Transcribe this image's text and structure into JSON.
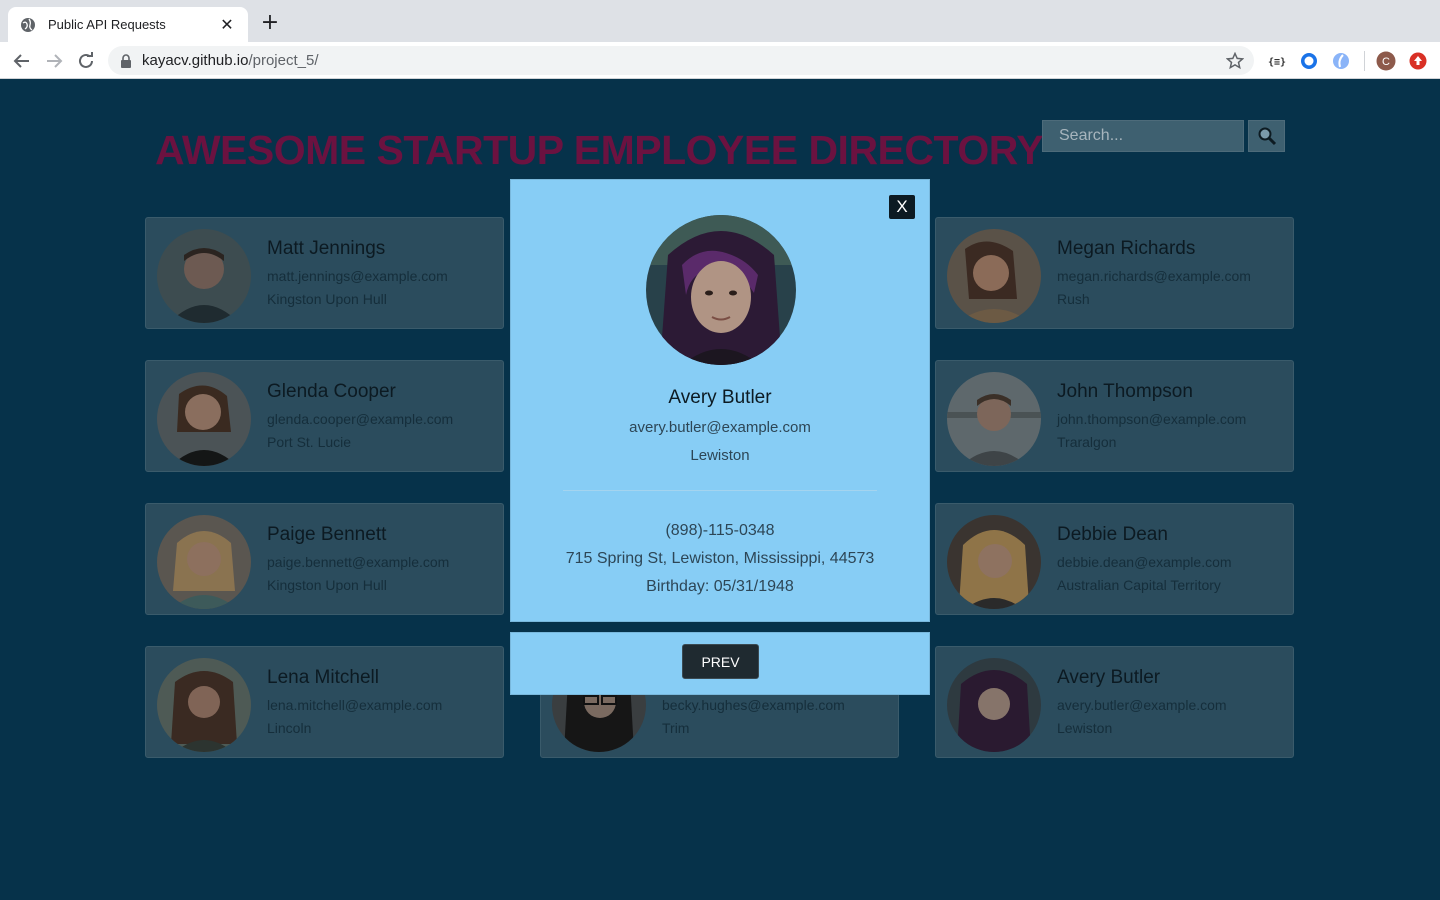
{
  "browser": {
    "tab_title": "Public API Requests",
    "tab_close": "✕",
    "new_tab": "+",
    "url_host": "kayacv.github.io",
    "url_path": "/project_5/",
    "profile_initial": "C"
  },
  "header": {
    "title": "AWESOME STARTUP EMPLOYEE DIRECTORY",
    "search_placeholder": "Search..."
  },
  "cards": [
    {
      "name": "Matt Jennings",
      "email": "matt.jennings@example.com",
      "city": "Kingston Upon Hull"
    },
    {
      "name": "Megan Richards",
      "email": "megan.richards@example.com",
      "city": "Rush"
    },
    {
      "name": "Glenda Cooper",
      "email": "glenda.cooper@example.com",
      "city": "Port St. Lucie"
    },
    {
      "name": "John Thompson",
      "email": "john.thompson@example.com",
      "city": "Traralgon"
    },
    {
      "name": "Paige Bennett",
      "email": "paige.bennett@example.com",
      "city": "Kingston Upon Hull"
    },
    {
      "name": "Debbie Dean",
      "email": "debbie.dean@example.com",
      "city": "Australian Capital Territory"
    },
    {
      "name": "Lena Mitchell",
      "email": "lena.mitchell@example.com",
      "city": "Lincoln"
    },
    {
      "email": "becky.hughes@example.com",
      "city": "Trim"
    },
    {
      "name": "Avery Butler",
      "email": "avery.butler@example.com",
      "city": "Lewiston"
    }
  ],
  "modal": {
    "close_label": "X",
    "name": "Avery Butler",
    "email": "avery.butler@example.com",
    "city": "Lewiston",
    "phone": "(898)-115-0348",
    "address": "715 Spring St, Lewiston, Mississippi, 44573",
    "birthday": "Birthday: 05/31/1948",
    "prev_label": "PREV"
  },
  "colors": {
    "page_background": "#06324a",
    "modal_background": "#87cdf5",
    "title_color": "#6b1240"
  }
}
